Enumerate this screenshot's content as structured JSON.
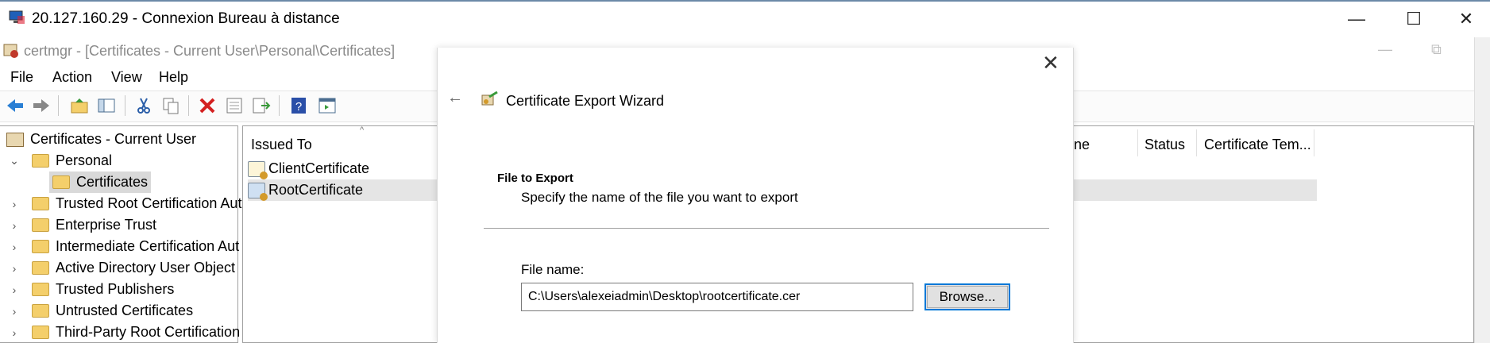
{
  "rdp": {
    "title": "20.127.160.29 - Connexion Bureau à distance",
    "minimize": "—",
    "maximize": "☐",
    "close": "✕"
  },
  "certmgr": {
    "title": "certmgr - [Certificates - Current User\\Personal\\Certificates]",
    "minimize": "—",
    "restore": "⧉"
  },
  "menu": [
    "File",
    "Action",
    "View",
    "Help"
  ],
  "toolbar": {
    "icons": [
      "back-arrow-icon",
      "forward-arrow-icon",
      "up-folder-icon",
      "show-hide-tree-icon",
      "cut-icon",
      "copy-icon",
      "delete-icon",
      "properties-icon",
      "export-list-icon",
      "help-icon",
      "action-pane-icon"
    ]
  },
  "tree": {
    "root": "Certificates - Current User",
    "items": [
      {
        "label": "Personal",
        "expanded": true
      },
      {
        "label": "Certificates",
        "selected": true
      },
      {
        "label": "Trusted Root Certification Aut"
      },
      {
        "label": "Enterprise Trust"
      },
      {
        "label": "Intermediate Certification Aut"
      },
      {
        "label": "Active Directory User Object"
      },
      {
        "label": "Trusted Publishers"
      },
      {
        "label": "Untrusted Certificates"
      },
      {
        "label": "Third-Party Root Certification"
      }
    ]
  },
  "list": {
    "columns": {
      "issued_to": "Issued To",
      "name_fragment": "ne",
      "status": "Status",
      "template": "Certificate Tem..."
    },
    "rows": [
      {
        "issued_to": "ClientCertificate"
      },
      {
        "issued_to": "RootCertificate",
        "selected": true
      }
    ]
  },
  "wizard": {
    "back": "←",
    "close": "✕",
    "title": "Certificate Export Wizard",
    "section_title": "File to Export",
    "section_subtitle": "Specify the name of the file you want to export",
    "file_label": "File name:",
    "file_value": "C:\\Users\\alexeiadmin\\Desktop\\rootcertificate.cer",
    "browse_label": "Browse..."
  }
}
